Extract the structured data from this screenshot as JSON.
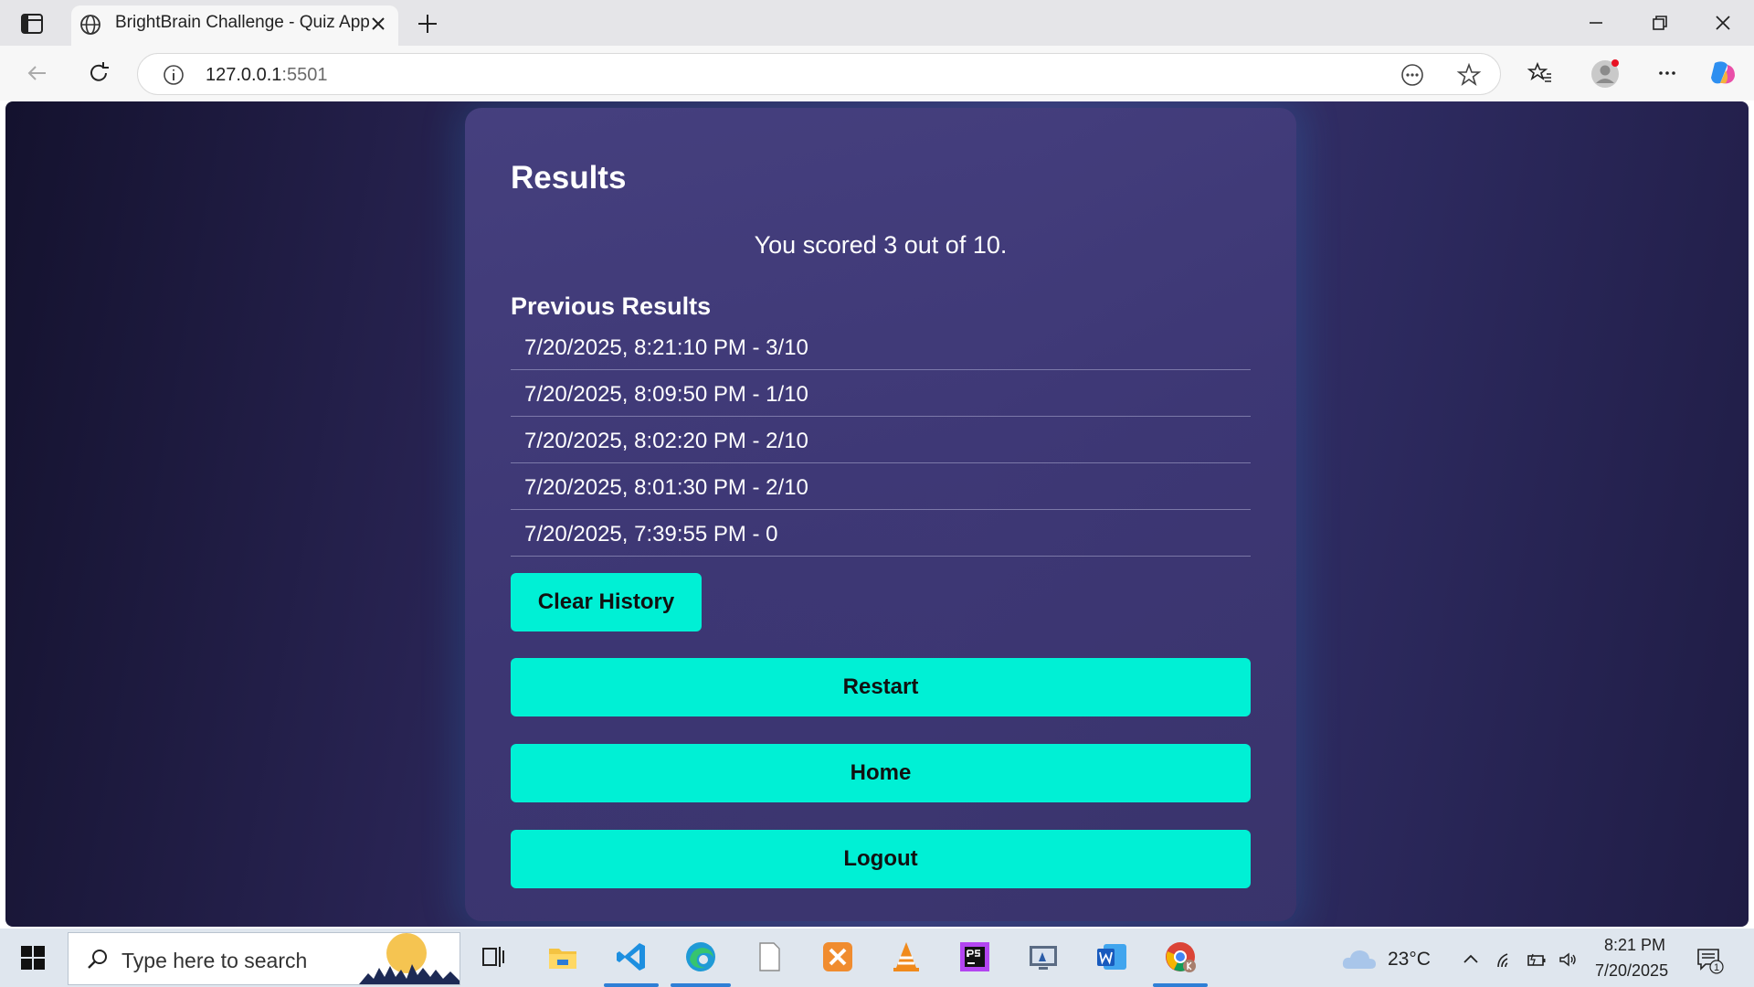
{
  "browser": {
    "tab_title": "BrightBrain Challenge - Quiz App",
    "url_host": "127.0.0.1",
    "url_port": ":5501"
  },
  "page": {
    "results_heading": "Results",
    "score_text": "You scored 3 out of 10.",
    "previous_heading": "Previous Results",
    "history": [
      "7/20/2025, 8:21:10 PM - 3/10",
      "7/20/2025, 8:09:50 PM - 1/10",
      "7/20/2025, 8:02:20 PM - 2/10",
      "7/20/2025, 8:01:30 PM - 2/10",
      "7/20/2025, 7:39:55 PM - 0"
    ],
    "clear_history_label": "Clear History",
    "restart_label": "Restart",
    "home_label": "Home",
    "logout_label": "Logout",
    "accent_color": "#00f0d5"
  },
  "taskbar": {
    "search_placeholder": "Type here to search",
    "weather": "23°C",
    "time": "8:21 PM",
    "date": "7/20/2025",
    "notification_count": "1"
  }
}
